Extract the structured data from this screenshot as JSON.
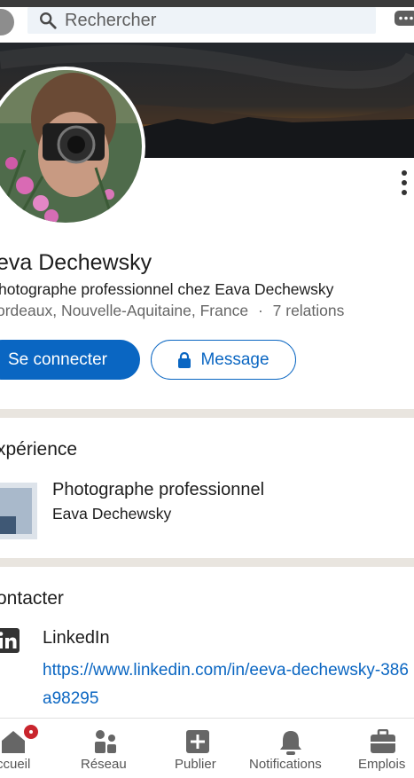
{
  "search": {
    "placeholder": "Rechercher"
  },
  "profile": {
    "name": "eva Dechewsky",
    "headline": "hotographe professionnel chez Eava Dechewsky",
    "location": "ordeaux, Nouvelle-Aquitaine, France",
    "separator": "·",
    "relations": "7 relations"
  },
  "actions": {
    "connect_label": "Se connecter",
    "message_label": "Message"
  },
  "experience": {
    "title": "xpérience",
    "items": [
      {
        "role": "Photographe professionnel",
        "company": "Eava Dechewsky"
      }
    ]
  },
  "contact": {
    "title": "ontacter",
    "items": [
      {
        "label": "LinkedIn",
        "url": "https://www.linkedin.com/in/eeva-dechewsky-386a98295"
      }
    ]
  },
  "bottom_nav": {
    "items": [
      {
        "label": "ccueil",
        "icon": "home-icon"
      },
      {
        "label": "Réseau",
        "icon": "network-icon"
      },
      {
        "label": "Publier",
        "icon": "post-icon"
      },
      {
        "label": "Notifications",
        "icon": "bell-icon"
      },
      {
        "label": "Emplois",
        "icon": "briefcase-icon"
      }
    ]
  },
  "colors": {
    "brand_blue": "#0a66c2",
    "divider": "#e9e5df",
    "badge_red": "#c9252d"
  }
}
